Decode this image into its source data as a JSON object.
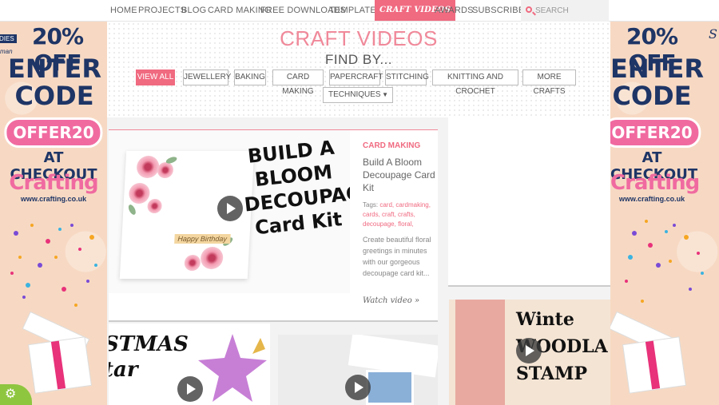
{
  "nav": {
    "items": [
      {
        "label": "HOME"
      },
      {
        "label": "PROJECTS"
      },
      {
        "label": "BLOG"
      },
      {
        "label": "CARD MAKING"
      },
      {
        "label": "FREE DOWNLOADS"
      },
      {
        "label": "TEMPLATES"
      },
      {
        "label": "Craft Videos",
        "active": true
      },
      {
        "label": "AWARDS"
      },
      {
        "label": "SUBSCRIBE"
      }
    ],
    "search_placeholder": "SEARCH"
  },
  "ad": {
    "discount": "20% OFF",
    "enter_code": "ENTER CODE",
    "code": "OFFER20",
    "checkout": "AT CHECKOUT",
    "brand": "Crafting",
    "url": "www.crafting.co.uk",
    "left_corner_1": "DIES",
    "left_corner_2": "man",
    "right_corner": "S"
  },
  "page": {
    "title": "CRAFT VIDEOS",
    "find_by": "FIND BY...",
    "filters": [
      "VIEW ALL",
      "JEWELLERY",
      "BAKING",
      "CARD MAKING",
      "PAPERCRAFT",
      "STITCHING",
      "KNITTING AND CROCHET",
      "MORE CRAFTS"
    ],
    "technique_select": "TECHNIQUES"
  },
  "feature": {
    "category": "CARD MAKING",
    "title": "Build A Bloom Decoupage Card Kit",
    "tags_label": "Tags:",
    "tags": [
      "card,",
      "cardmaking,",
      "cards,",
      "craft,",
      "crafts,",
      "decoupage,",
      "floral,"
    ],
    "description": "Create beautiful floral greetings in minutes with our gorgeous decoupage card kit...",
    "watch": "Watch video »",
    "image_text": "BUILD A BLOOM DECOUPAGE Card Kit",
    "card_text": "Happy Birthday"
  },
  "thumbs": {
    "t1_text": "STMAS tar",
    "t2_text": "",
    "t3_text": "Winte WOODLA STAMP"
  },
  "colors": {
    "accent": "#f06a80",
    "ad_navy": "#1e3566",
    "ad_pink": "#f06aa0"
  }
}
